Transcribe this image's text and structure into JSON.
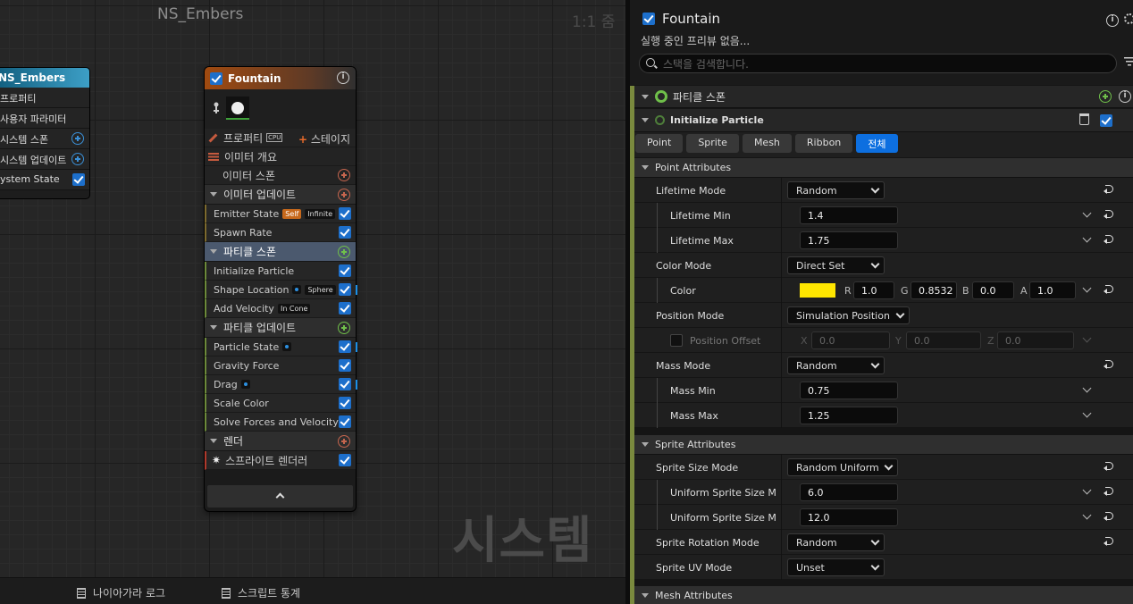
{
  "graph": {
    "title": "NS_Embers",
    "zoom": "1:1 줌",
    "watermark": "시스템",
    "footer": {
      "log": "나이아가라 로그",
      "stats": "스크립트 통계"
    }
  },
  "system_node": {
    "title": "NS_Embers",
    "rows": [
      "프로퍼티",
      "사용자 파라미터",
      "시스템 스폰",
      "시스템 업데이트",
      "ystem State"
    ]
  },
  "emitter_node": {
    "title": "Fountain",
    "properties": "프로퍼티",
    "cpu": "CPU",
    "stage": "스테이지",
    "overview": "이미터 개요",
    "emitter_spawn": "이미터 스폰",
    "emitter_update": "이미터 업데이트",
    "emitter_state": "Emitter State",
    "tag_self": "Self",
    "tag_infinite": "Infinite",
    "spawn_rate": "Spawn Rate",
    "particle_spawn": "파티클 스폰",
    "init_particle": "Initialize Particle",
    "shape_location": "Shape Location",
    "tag_sphere": "Sphere",
    "add_velocity": "Add Velocity",
    "tag_incone": "In Cone",
    "particle_update": "파티클 업데이트",
    "particle_state": "Particle State",
    "gravity_force": "Gravity Force",
    "drag": "Drag",
    "scale_color": "Scale Color",
    "solve_forces": "Solve Forces and Velocity",
    "render": "렌더",
    "sprite_renderer": "스프라이트 렌더러"
  },
  "panel": {
    "title": "Fountain",
    "subtitle": "실행 중인 프리뷰 없음...",
    "search_placeholder": "스택을 검색합니다.",
    "group": "파티클 스폰",
    "module": "Initialize Particle",
    "tabs": [
      "Point",
      "Sprite",
      "Mesh",
      "Ribbon",
      "전체"
    ],
    "active_tab": "전체",
    "point_attributes": "Point Attributes",
    "lifetime_mode": {
      "label": "Lifetime Mode",
      "value": "Random"
    },
    "lifetime_min": {
      "label": "Lifetime Min",
      "value": "1.4"
    },
    "lifetime_max": {
      "label": "Lifetime Max",
      "value": "1.75"
    },
    "color_mode": {
      "label": "Color Mode",
      "value": "Direct Set"
    },
    "color": {
      "label": "Color",
      "swatch": "#ffe600",
      "r": "1.0",
      "g": "0.8532",
      "b": "0.0",
      "a": "1.0",
      "r_label": "R",
      "g_label": "G",
      "b_label": "B",
      "a_label": "A"
    },
    "position_mode": {
      "label": "Position Mode",
      "value": "Simulation Position"
    },
    "position_offset": {
      "label": "Position Offset",
      "x": "0.0",
      "y": "0.0",
      "z": "0.0",
      "x_label": "X",
      "y_label": "Y",
      "z_label": "Z"
    },
    "mass_mode": {
      "label": "Mass Mode",
      "value": "Random"
    },
    "mass_min": {
      "label": "Mass Min",
      "value": "0.75"
    },
    "mass_max": {
      "label": "Mass Max",
      "value": "1.25"
    },
    "sprite_attributes": "Sprite Attributes",
    "sprite_size_mode": {
      "label": "Sprite Size Mode",
      "value": "Random Uniform"
    },
    "uniform_min": {
      "label": "Uniform Sprite Size Min",
      "value": "6.0"
    },
    "uniform_max": {
      "label": "Uniform Sprite Size Max",
      "value": "12.0"
    },
    "sprite_rotation_mode": {
      "label": "Sprite Rotation Mode",
      "value": "Random"
    },
    "sprite_uv_mode": {
      "label": "Sprite UV Mode",
      "value": "Unset"
    },
    "mesh_attributes": "Mesh Attributes"
  }
}
